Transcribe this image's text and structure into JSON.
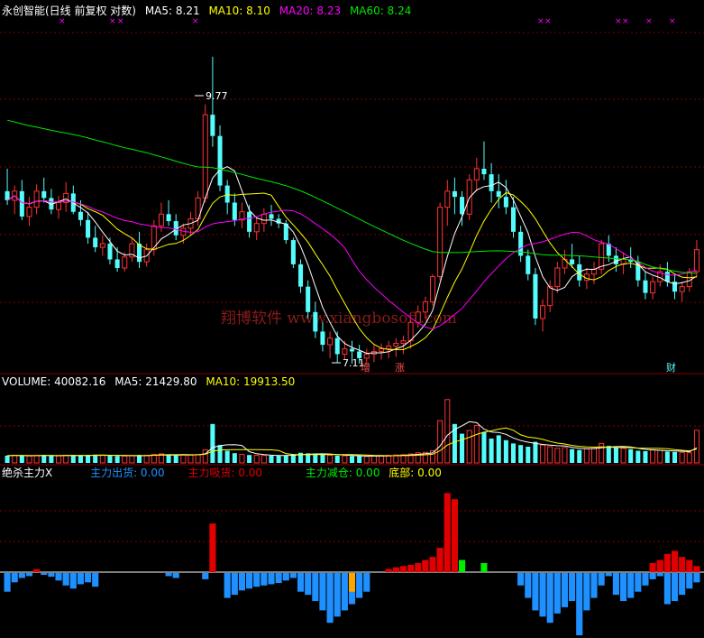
{
  "colors": {
    "bg": "#000000",
    "up": "#ff3232",
    "down": "#54fcfc",
    "grid": "#800000",
    "white": "#ffffff",
    "yellow": "#ffff00",
    "magenta": "#ff00ff",
    "green": "#00e600",
    "blue": "#1e90ff",
    "red": "#e00000",
    "ind_green": "#00ee00",
    "orange": "#ffa500",
    "watermark": "#8c1a1a"
  },
  "price_panel": {
    "title": "永创智能(日线 前复权 对数)",
    "ma5": "MA5: 8.21",
    "ma10": "MA10: 8.10",
    "ma20": "MA20: 8.23",
    "ma60": "MA60: 8.24",
    "high_label": "9.77",
    "low_label": "7.11",
    "marker_zeng": "增",
    "marker_zhang": "涨",
    "marker_cai": "财",
    "watermark": "翔博软件 www.xiangbosoft.com"
  },
  "volume_panel": {
    "volume": "VOLUME: 40082.16",
    "ma5": "MA5: 21429.80",
    "ma10": "MA10: 19913.50"
  },
  "indicator_panel": {
    "name": "绝杀主力X",
    "out": "主力出货: 0.00",
    "absorb": "主力吸货: 0.00",
    "reduce": "主力减仓: 0.00",
    "bottom": "底部: 0.00"
  },
  "chart_data": [
    {
      "type": "candlestick",
      "title": "永创智能(日线 前复权 对数)",
      "value_range": [
        7.05,
        10.15
      ],
      "annotations": [
        {
          "label": "9.77",
          "at_candle": 28,
          "value": 9.77
        },
        {
          "label": "7.11",
          "at_candle": 48,
          "value": 7.11
        }
      ],
      "candles": [
        [
          8.5,
          8.7,
          8.38,
          8.42
        ],
        [
          8.42,
          8.55,
          8.3,
          8.5
        ],
        [
          8.5,
          8.6,
          8.25,
          8.28
        ],
        [
          8.28,
          8.45,
          8.2,
          8.36
        ],
        [
          8.36,
          8.56,
          8.3,
          8.5
        ],
        [
          8.5,
          8.62,
          8.4,
          8.44
        ],
        [
          8.44,
          8.52,
          8.3,
          8.34
        ],
        [
          8.34,
          8.46,
          8.26,
          8.4
        ],
        [
          8.4,
          8.58,
          8.32,
          8.48
        ],
        [
          8.48,
          8.55,
          8.3,
          8.32
        ],
        [
          8.32,
          8.42,
          8.2,
          8.25
        ],
        [
          8.25,
          8.32,
          8.05,
          8.1
        ],
        [
          8.1,
          8.2,
          7.98,
          8.02
        ],
        [
          8.02,
          8.12,
          7.95,
          8.05
        ],
        [
          8.05,
          8.1,
          7.88,
          7.92
        ],
        [
          7.92,
          8.02,
          7.82,
          7.85
        ],
        [
          7.85,
          7.98,
          7.82,
          7.94
        ],
        [
          7.94,
          8.1,
          7.9,
          8.05
        ],
        [
          8.05,
          8.15,
          7.85,
          7.9
        ],
        [
          7.9,
          8.05,
          7.86,
          8.0
        ],
        [
          8.0,
          8.25,
          7.95,
          8.2
        ],
        [
          8.2,
          8.4,
          8.15,
          8.3
        ],
        [
          8.3,
          8.42,
          8.2,
          8.24
        ],
        [
          8.24,
          8.3,
          8.08,
          8.12
        ],
        [
          8.12,
          8.22,
          8.05,
          8.18
        ],
        [
          8.18,
          8.32,
          8.12,
          8.26
        ],
        [
          8.26,
          8.5,
          8.2,
          8.44
        ],
        [
          8.44,
          9.3,
          8.4,
          9.2
        ],
        [
          9.2,
          9.77,
          8.9,
          9.0
        ],
        [
          9.0,
          9.1,
          8.5,
          8.55
        ],
        [
          8.55,
          8.6,
          8.3,
          8.4
        ],
        [
          8.4,
          8.48,
          8.2,
          8.25
        ],
        [
          8.25,
          8.4,
          8.18,
          8.32
        ],
        [
          8.32,
          8.38,
          8.1,
          8.15
        ],
        [
          8.15,
          8.28,
          8.08,
          8.22
        ],
        [
          8.22,
          8.35,
          8.15,
          8.3
        ],
        [
          8.3,
          8.38,
          8.2,
          8.26
        ],
        [
          8.26,
          8.3,
          8.18,
          8.22
        ],
        [
          8.22,
          8.25,
          8.05,
          8.08
        ],
        [
          8.08,
          8.1,
          7.85,
          7.88
        ],
        [
          7.88,
          7.92,
          7.65,
          7.7
        ],
        [
          7.7,
          7.75,
          7.45,
          7.5
        ],
        [
          7.5,
          7.58,
          7.3,
          7.35
        ],
        [
          7.35,
          7.42,
          7.2,
          7.25
        ],
        [
          7.25,
          7.35,
          7.15,
          7.3
        ],
        [
          7.3,
          7.35,
          7.12,
          7.18
        ],
        [
          7.18,
          7.28,
          7.14,
          7.22
        ],
        [
          7.22,
          7.28,
          7.11,
          7.2
        ],
        [
          7.2,
          7.25,
          7.11,
          7.15
        ],
        [
          7.15,
          7.22,
          7.11,
          7.18
        ],
        [
          7.18,
          7.25,
          7.12,
          7.2
        ],
        [
          7.2,
          7.26,
          7.14,
          7.22
        ],
        [
          7.22,
          7.28,
          7.15,
          7.24
        ],
        [
          7.24,
          7.3,
          7.16,
          7.26
        ],
        [
          7.26,
          7.32,
          7.18,
          7.28
        ],
        [
          7.28,
          7.44,
          7.22,
          7.42
        ],
        [
          7.42,
          7.55,
          7.38,
          7.5
        ],
        [
          7.5,
          7.62,
          7.45,
          7.58
        ],
        [
          7.58,
          7.8,
          7.55,
          7.78
        ],
        [
          7.78,
          8.4,
          7.75,
          8.36
        ],
        [
          8.36,
          8.6,
          8.2,
          8.5
        ],
        [
          8.5,
          8.62,
          8.3,
          8.45
        ],
        [
          8.45,
          8.5,
          8.2,
          8.3
        ],
        [
          8.3,
          8.65,
          8.25,
          8.6
        ],
        [
          8.6,
          8.8,
          8.5,
          8.7
        ],
        [
          8.7,
          8.95,
          8.6,
          8.65
        ],
        [
          8.65,
          8.75,
          8.4,
          8.5
        ],
        [
          8.5,
          8.65,
          8.35,
          8.45
        ],
        [
          8.45,
          8.6,
          8.3,
          8.36
        ],
        [
          8.36,
          8.45,
          8.1,
          8.15
        ],
        [
          8.15,
          8.2,
          7.9,
          7.95
        ],
        [
          7.95,
          8.0,
          7.75,
          7.8
        ],
        [
          7.8,
          7.85,
          7.4,
          7.45
        ],
        [
          7.45,
          7.6,
          7.35,
          7.55
        ],
        [
          7.55,
          7.75,
          7.5,
          7.7
        ],
        [
          7.7,
          7.9,
          7.65,
          7.85
        ],
        [
          7.85,
          8.0,
          7.8,
          7.92
        ],
        [
          7.92,
          8.05,
          7.85,
          7.88
        ],
        [
          7.88,
          7.95,
          7.7,
          7.75
        ],
        [
          7.75,
          7.85,
          7.68,
          7.8
        ],
        [
          7.8,
          7.9,
          7.72,
          7.84
        ],
        [
          7.84,
          8.08,
          7.8,
          8.05
        ],
        [
          8.05,
          8.12,
          7.9,
          7.95
        ],
        [
          7.95,
          8.02,
          7.82,
          7.88
        ],
        [
          7.88,
          7.98,
          7.8,
          7.92
        ],
        [
          7.92,
          8.02,
          7.85,
          7.9
        ],
        [
          7.9,
          7.95,
          7.7,
          7.75
        ],
        [
          7.75,
          7.82,
          7.6,
          7.65
        ],
        [
          7.65,
          7.78,
          7.6,
          7.74
        ],
        [
          7.74,
          7.88,
          7.7,
          7.82
        ],
        [
          7.82,
          7.9,
          7.7,
          7.74
        ],
        [
          7.74,
          7.8,
          7.6,
          7.66
        ],
        [
          7.66,
          7.74,
          7.58,
          7.7
        ],
        [
          7.7,
          7.85,
          7.66,
          7.82
        ],
        [
          7.82,
          8.08,
          7.78,
          8.0
        ]
      ]
    },
    {
      "type": "bar",
      "title": "VOLUME",
      "ylim": [
        0,
        90000
      ],
      "values": [
        9000,
        9500,
        8800,
        8500,
        9200,
        9800,
        9000,
        8600,
        9400,
        9600,
        8900,
        9800,
        10200,
        9600,
        8800,
        8400,
        8500,
        9000,
        9800,
        9300,
        10500,
        11200,
        10000,
        9500,
        10200,
        9800,
        10400,
        16000,
        48000,
        22000,
        15000,
        12000,
        10500,
        9800,
        9500,
        9200,
        9000,
        8800,
        9600,
        10800,
        12500,
        11800,
        11000,
        10200,
        9500,
        9000,
        8800,
        8500,
        8200,
        8000,
        8600,
        9000,
        9400,
        9800,
        10200,
        11000,
        12500,
        13000,
        15000,
        52000,
        78000,
        48000,
        36000,
        40000,
        46000,
        38000,
        30000,
        34000,
        28000,
        24000,
        22000,
        20000,
        26000,
        22000,
        20000,
        18000,
        19000,
        17000,
        16000,
        17500,
        19000,
        24000,
        21000,
        19000,
        18000,
        17000,
        15000,
        14500,
        16000,
        15500,
        14000,
        13500,
        13000,
        12500,
        40082
      ]
    },
    {
      "type": "bar",
      "title": "绝杀主力X",
      "ylim": [
        -100,
        150
      ],
      "series": [
        {
          "name": "主力出货",
          "values": [
            -30,
            -15,
            -8,
            -5,
            0,
            -3,
            -6,
            -12,
            -20,
            -25,
            -18,
            -15,
            -22,
            0,
            0,
            0,
            0,
            0,
            0,
            0,
            0,
            0,
            -5,
            -8,
            0,
            0,
            0,
            -10,
            0,
            0,
            -40,
            -35,
            -28,
            -25,
            -22,
            -20,
            -18,
            -16,
            -12,
            -8,
            -30,
            -35,
            -45,
            -60,
            -80,
            -70,
            -60,
            -50,
            -40,
            -30,
            0,
            0,
            0,
            0,
            0,
            0,
            0,
            0,
            0,
            0,
            0,
            0,
            0,
            0,
            0,
            0,
            0,
            0,
            0,
            0,
            -20,
            -40,
            -60,
            -70,
            -80,
            -65,
            -55,
            -45,
            -100,
            -60,
            -40,
            -20,
            -5,
            -35,
            -45,
            -40,
            -30,
            -20,
            -10,
            -5,
            -50,
            -45,
            -35,
            -25,
            -15
          ]
        },
        {
          "name": "主力吸货",
          "values": [
            0,
            0,
            0,
            0,
            5,
            0,
            0,
            0,
            0,
            0,
            0,
            0,
            0,
            0,
            0,
            0,
            0,
            0,
            0,
            0,
            0,
            0,
            0,
            0,
            0,
            0,
            0,
            0,
            80,
            0,
            0,
            0,
            0,
            0,
            0,
            0,
            0,
            0,
            0,
            0,
            0,
            0,
            0,
            0,
            0,
            0,
            0,
            0,
            0,
            0,
            0,
            0,
            5,
            8,
            10,
            12,
            15,
            20,
            25,
            40,
            130,
            120,
            0,
            0,
            0,
            0,
            0,
            0,
            0,
            0,
            0,
            0,
            0,
            0,
            0,
            0,
            0,
            0,
            0,
            0,
            0,
            0,
            0,
            0,
            0,
            0,
            0,
            0,
            15,
            20,
            30,
            35,
            25,
            20,
            10
          ]
        },
        {
          "name": "主力减仓",
          "values": [
            0,
            0,
            0,
            0,
            0,
            0,
            0,
            0,
            0,
            0,
            0,
            0,
            0,
            0,
            0,
            0,
            0,
            0,
            0,
            0,
            0,
            0,
            0,
            0,
            0,
            0,
            0,
            0,
            0,
            0,
            0,
            0,
            0,
            0,
            0,
            0,
            0,
            0,
            0,
            0,
            0,
            0,
            0,
            0,
            0,
            0,
            0,
            0,
            0,
            0,
            0,
            0,
            0,
            0,
            0,
            0,
            0,
            0,
            0,
            0,
            0,
            0,
            20,
            0,
            0,
            15,
            0,
            0,
            0,
            0,
            0,
            0,
            0,
            0,
            0,
            0,
            0,
            0,
            0,
            0,
            0,
            0,
            0,
            0,
            0,
            0,
            0,
            0,
            0,
            0,
            0,
            0,
            0,
            0,
            0
          ]
        },
        {
          "name": "底部",
          "values": [
            0,
            0,
            0,
            0,
            0,
            0,
            0,
            0,
            0,
            0,
            0,
            0,
            0,
            0,
            0,
            0,
            0,
            0,
            0,
            0,
            0,
            0,
            0,
            0,
            0,
            0,
            0,
            0,
            0,
            0,
            0,
            0,
            0,
            0,
            0,
            0,
            0,
            0,
            0,
            0,
            0,
            0,
            0,
            0,
            0,
            0,
            0,
            -30,
            0,
            0,
            0,
            0,
            0,
            0,
            0,
            0,
            0,
            0,
            0,
            0,
            0,
            0,
            0,
            0,
            0,
            0,
            0,
            0,
            0,
            0,
            0,
            0,
            0,
            0,
            0,
            0,
            0,
            0,
            0,
            0,
            0,
            0,
            0,
            0,
            0,
            0,
            0,
            0,
            0,
            0,
            0,
            0,
            0,
            0,
            0
          ]
        }
      ]
    }
  ]
}
